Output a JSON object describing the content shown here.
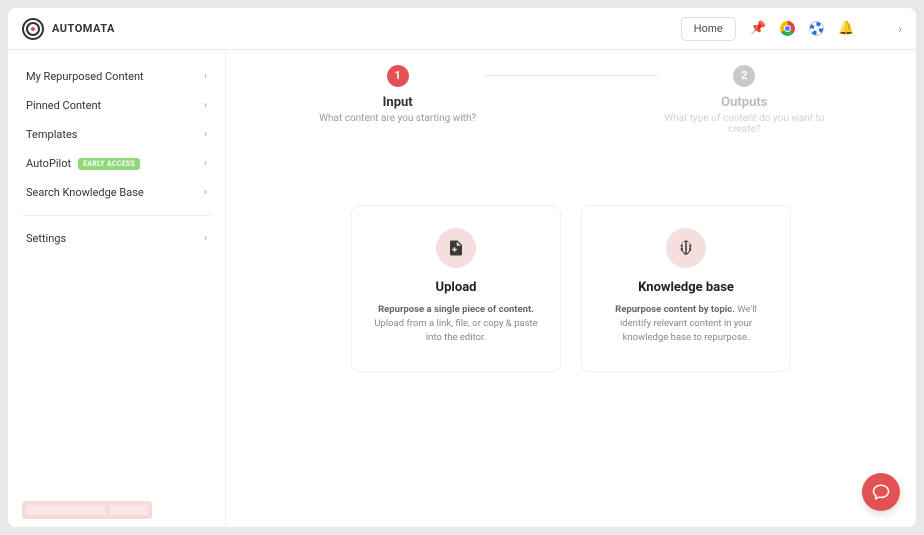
{
  "brand": "AUTOMATA",
  "header": {
    "home": "Home"
  },
  "sidebar": {
    "items": [
      {
        "label": "My Repurposed Content"
      },
      {
        "label": "Pinned Content"
      },
      {
        "label": "Templates"
      },
      {
        "label": "AutoPilot",
        "badge": "EARLY ACCESS"
      },
      {
        "label": "Search Knowledge Base"
      }
    ],
    "settings": "Settings"
  },
  "stepper": {
    "step1": {
      "num": "1",
      "title": "Input",
      "sub": "What content are you starting with?"
    },
    "step2": {
      "num": "2",
      "title": "Outputs",
      "sub": "What type of content do you want to create?"
    }
  },
  "cards": {
    "upload": {
      "title": "Upload",
      "lead": "Repurpose a single piece of content.",
      "rest": " Upload from a link, file, or copy & paste into the editor."
    },
    "kb": {
      "title": "Knowledge base",
      "lead": "Repurpose content by topic.",
      "rest": " We'll identify relevant content in your knowledge base to repurpose."
    }
  }
}
